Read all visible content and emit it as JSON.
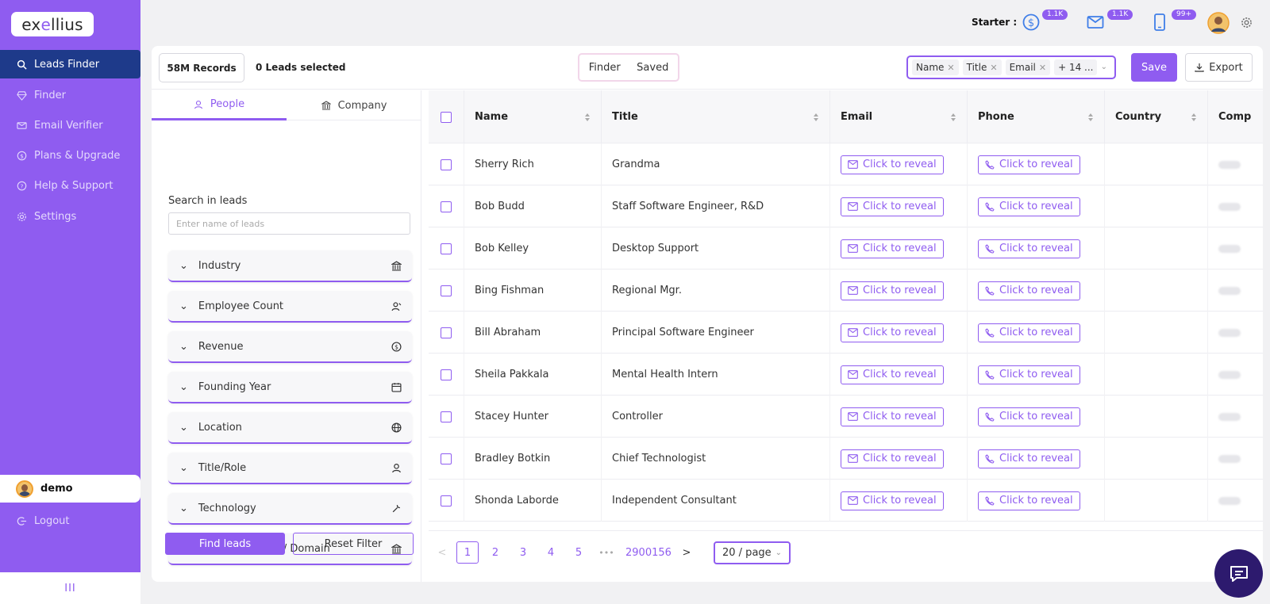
{
  "app": {
    "logo_prefix": "ex",
    "logo_accent": "e",
    "logo_suffix": "llius"
  },
  "sidebar": {
    "items": [
      {
        "label": "Leads Finder",
        "icon": "search-icon"
      },
      {
        "label": "Finder",
        "icon": "gem-icon"
      },
      {
        "label": "Email Verifier",
        "icon": "mail-icon"
      },
      {
        "label": "Plans & Upgrade",
        "icon": "dollar-icon"
      },
      {
        "label": "Help & Support",
        "icon": "help-icon"
      },
      {
        "label": "Settings",
        "icon": "gear-icon"
      }
    ],
    "user": "demo",
    "logout": "Logout",
    "collapse": "III"
  },
  "topbar": {
    "plan": "Starter :",
    "credits": {
      "dollar": "1.1K",
      "mail": "1.1K",
      "phone": "99+"
    }
  },
  "toolbar": {
    "records": "58M Records",
    "selected": "0 Leads selected",
    "mode": [
      "Finder",
      "Saved"
    ],
    "column_tags": [
      "Name",
      "Title",
      "Email",
      "+ 14 ..."
    ],
    "save": "Save",
    "export": "Export"
  },
  "filters": {
    "tabs": [
      "People",
      "Company"
    ],
    "search_label": "Search in leads",
    "search_placeholder": "Enter name of leads",
    "sections": [
      {
        "label": "Industry",
        "icon": "bank-icon"
      },
      {
        "label": "Employee Count",
        "icon": "users-icon"
      },
      {
        "label": "Revenue",
        "icon": "dollar-circle-icon"
      },
      {
        "label": "Founding Year",
        "icon": "calendar-icon"
      },
      {
        "label": "Location",
        "icon": "globe-icon"
      },
      {
        "label": "Title/Role",
        "icon": "user-icon"
      },
      {
        "label": "Technology",
        "icon": "tool-icon"
      },
      {
        "label": "Company name / Domain",
        "icon": "bank-icon"
      }
    ],
    "find": "Find leads",
    "reset": "Reset Filter"
  },
  "table": {
    "columns": [
      "Name",
      "Title",
      "Email",
      "Phone",
      "Country",
      "Comp"
    ],
    "reveal_label": "Click to reveal",
    "rows": [
      {
        "name": "Sherry Rich",
        "title": "Grandma"
      },
      {
        "name": "Bob Budd",
        "title": "Staff Software Engineer, R&D"
      },
      {
        "name": "Bob Kelley",
        "title": "Desktop Support"
      },
      {
        "name": "Bing Fishman",
        "title": "Regional Mgr."
      },
      {
        "name": "Bill Abraham",
        "title": "Principal Software Engineer"
      },
      {
        "name": "Sheila Pakkala",
        "title": "Mental Health Intern"
      },
      {
        "name": "Stacey Hunter",
        "title": "Controller"
      },
      {
        "name": "Bradley Botkin",
        "title": "Chief Technologist"
      },
      {
        "name": "Shonda Laborde",
        "title": "Independent Consultant"
      }
    ]
  },
  "pagination": {
    "prev": "<",
    "pages": [
      "1",
      "2",
      "3",
      "4",
      "5"
    ],
    "ellipsis": "•••",
    "last": "2900156",
    "next": ">",
    "page_size": "20 / page",
    "current": "1"
  },
  "colors": {
    "accent": "#8f5cf0",
    "active_nav": "#1e3a8a",
    "chat": "#2d1a6e"
  }
}
